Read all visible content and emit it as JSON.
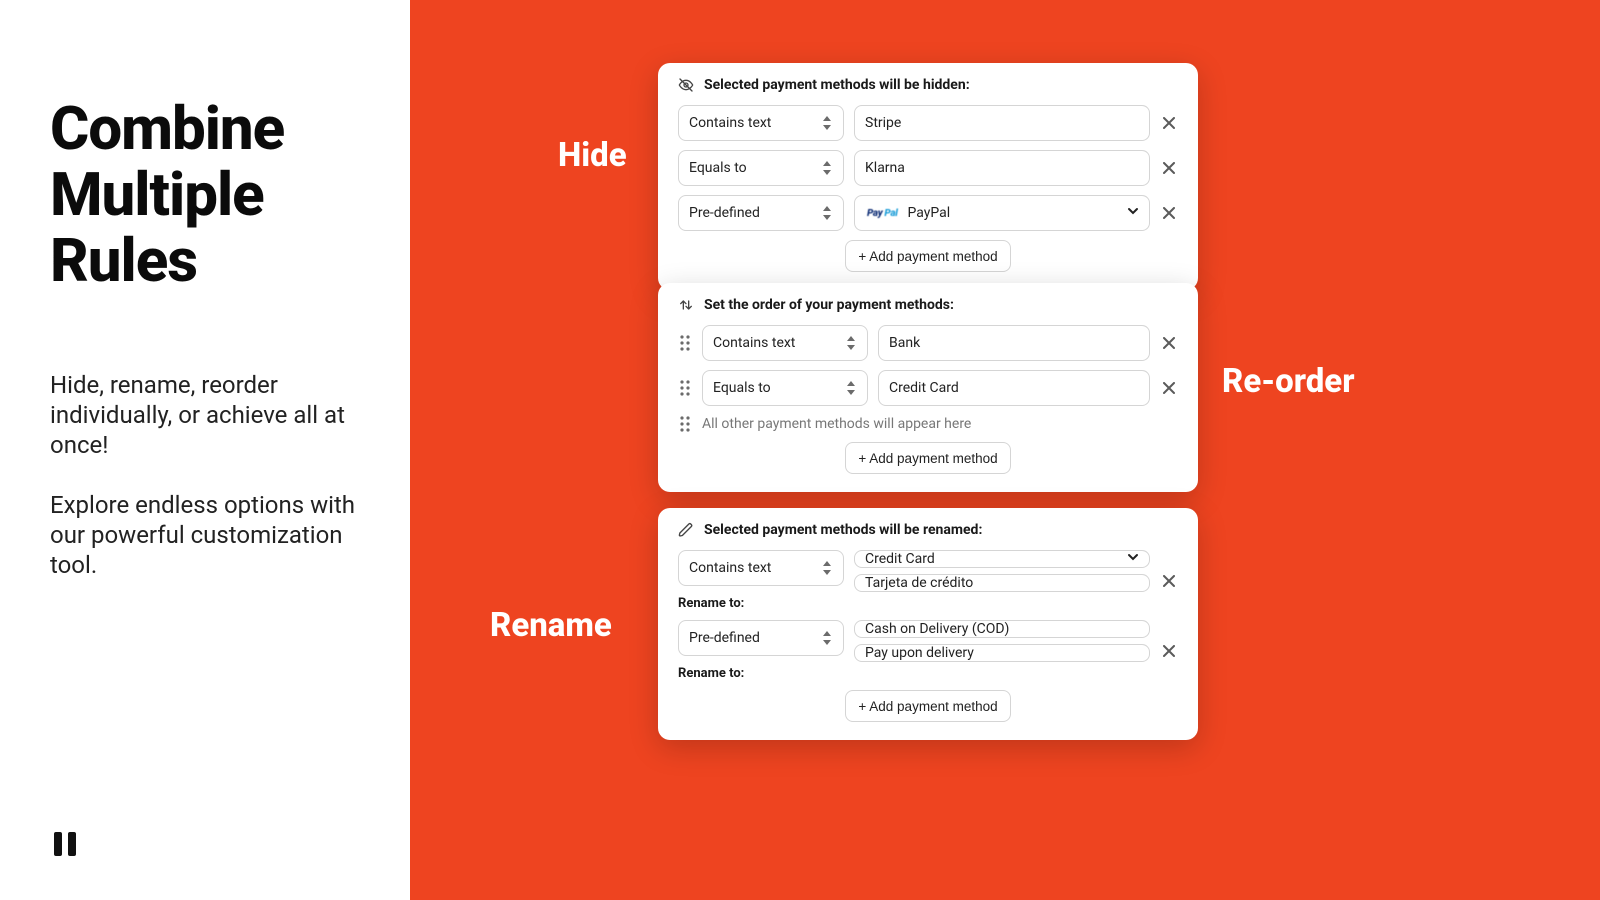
{
  "left": {
    "heading_l1": "Combine",
    "heading_l2": "Multiple",
    "heading_l3": "Rules",
    "desc1": "Hide, rename, reorder individually, or achieve all at once!",
    "desc2": "Explore endless options with our powerful customization tool."
  },
  "labels": {
    "hide": "Hide",
    "reorder": "Re-order",
    "rename": "Rename"
  },
  "addBtn": "+ Add payment method",
  "hide": {
    "heading": "Selected payment methods will be hidden:",
    "rows": [
      {
        "condition": "Contains text",
        "value": "Stripe",
        "kind": "text"
      },
      {
        "condition": "Equals to",
        "value": "Klarna",
        "kind": "text"
      },
      {
        "condition": "Pre-defined",
        "value": "PayPal",
        "kind": "dropdown",
        "brand": "paypal"
      }
    ]
  },
  "reorder": {
    "heading": "Set the order of your payment methods:",
    "rows": [
      {
        "condition": "Contains text",
        "value": "Bank"
      },
      {
        "condition": "Equals to",
        "value": "Credit Card"
      }
    ],
    "placeholderRow": "All other payment methods will appear here"
  },
  "rename": {
    "heading": "Selected payment methods will be renamed:",
    "renameLabel": "Rename to:",
    "rows": [
      {
        "condition": "Contains text",
        "value": "Credit Card",
        "valueKind": "dropdown",
        "renameTo": "Tarjeta de crédito"
      },
      {
        "condition": "Pre-defined",
        "value": "Cash on Delivery (COD)",
        "valueKind": "text",
        "renameTo": "Pay upon delivery"
      }
    ]
  }
}
